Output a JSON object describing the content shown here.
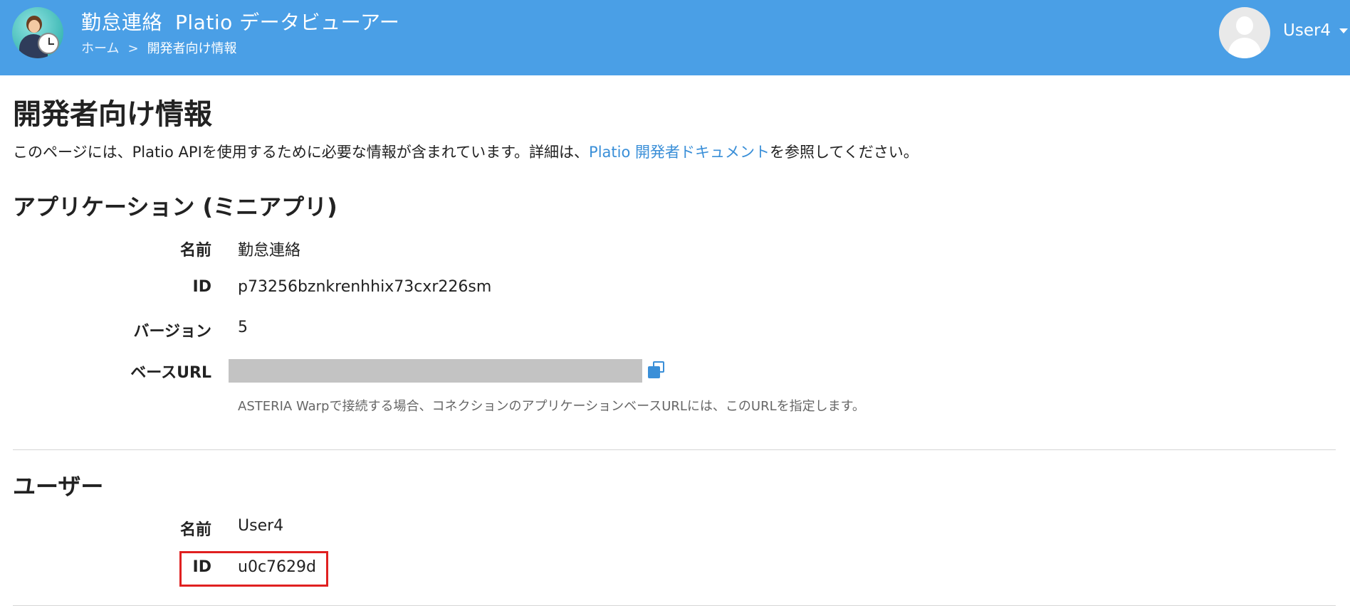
{
  "header": {
    "app_name": "勤怠連絡",
    "app_subtitle": "Platio データビューアー",
    "breadcrumb": {
      "home": "ホーム",
      "separator": ">",
      "current": "開発者向け情報"
    },
    "user": {
      "name": "User4"
    }
  },
  "page": {
    "title": "開発者向け情報",
    "intro_before": "このページには、Platio APIを使用するために必要な情報が含まれています。詳細は、",
    "intro_link": "Platio 開発者ドキュメント",
    "intro_after": "を参照してください。"
  },
  "application": {
    "section_title": "アプリケーション (ミニアプリ)",
    "name_label": "名前",
    "name_value": "勤怠連絡",
    "id_label": "ID",
    "id_value": "p73256bznkrenhhix73cxr226sm",
    "version_label": "バージョン",
    "version_value": "5",
    "base_url_label": "ベースURL",
    "base_url_hint": "ASTERIA Warpで接続する場合、コネクションのアプリケーションベースURLには、このURLを指定します。"
  },
  "user_section": {
    "section_title": "ユーザー",
    "name_label": "名前",
    "name_value": "User4",
    "id_label": "ID",
    "id_value": "u0c7629d"
  },
  "colors": {
    "header_bg": "#4a9fe6",
    "link": "#3a8fd8",
    "highlight": "#e02020"
  },
  "icons": [
    "app-logo-icon",
    "user-avatar-icon",
    "chevron-down-icon",
    "copy-icon"
  ]
}
